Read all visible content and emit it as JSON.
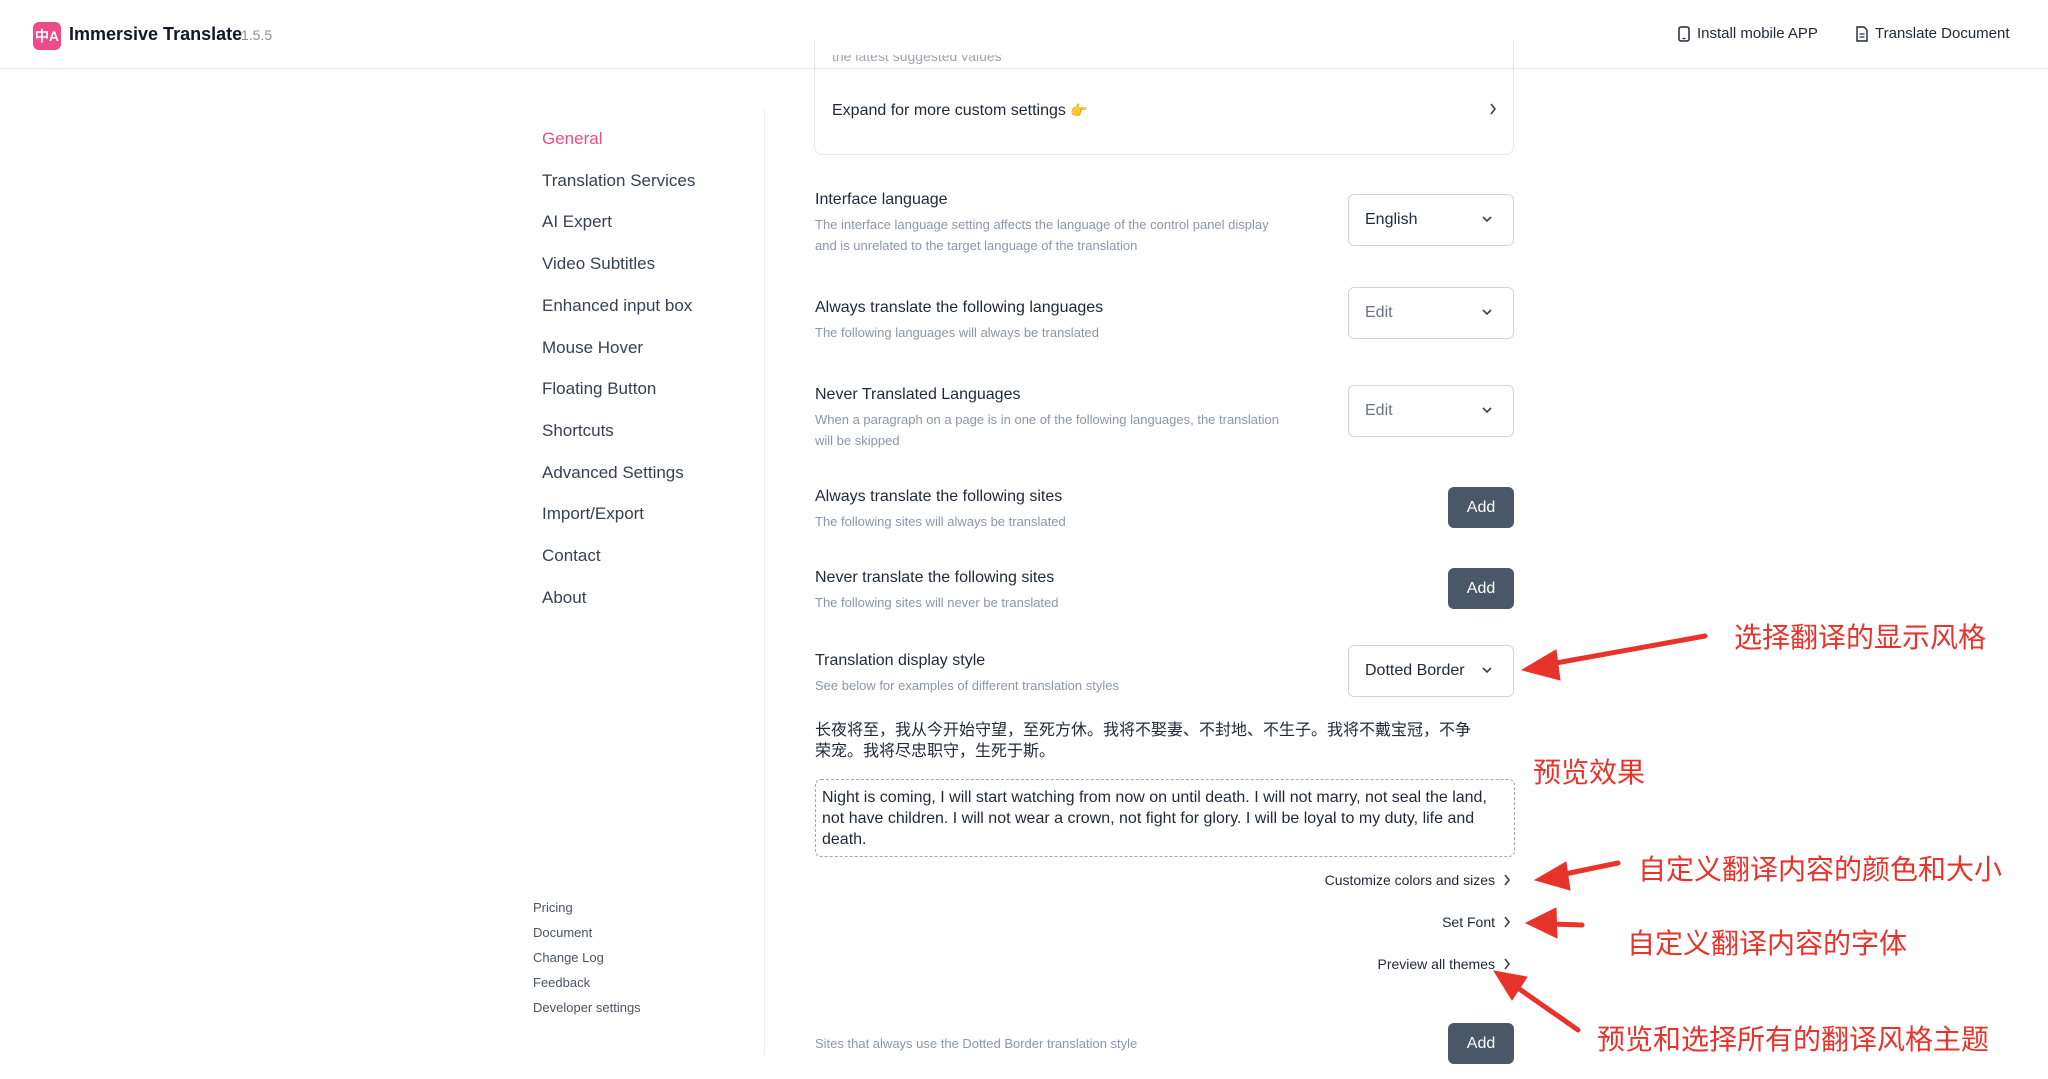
{
  "header": {
    "logo_text": "中A",
    "app_name": "Immersive Translate",
    "version": "1.5.5",
    "install_mobile": "Install mobile APP",
    "translate_document": "Translate Document"
  },
  "sidebar": {
    "items": [
      {
        "label": "General",
        "active": true
      },
      {
        "label": "Translation Services"
      },
      {
        "label": "AI Expert"
      },
      {
        "label": "Video Subtitles"
      },
      {
        "label": "Enhanced input box"
      },
      {
        "label": "Mouse Hover"
      },
      {
        "label": "Floating Button"
      },
      {
        "label": "Shortcuts"
      },
      {
        "label": "Advanced Settings"
      },
      {
        "label": "Import/Export"
      },
      {
        "label": "Contact"
      },
      {
        "label": "About"
      }
    ],
    "footer_links": [
      "Pricing",
      "Document",
      "Change Log",
      "Feedback",
      "Developer settings"
    ]
  },
  "top_card": {
    "faded_text": "the latest suggested values",
    "expand_label": "Expand for more custom settings",
    "expand_emoji": "👉"
  },
  "settings": {
    "interface_language": {
      "title": "Interface language",
      "desc_line1": "The interface language setting affects the language of the control panel display",
      "desc_line2": "and is unrelated to the target language of the translation",
      "value": "English"
    },
    "always_translate_langs": {
      "title": "Always translate the following languages",
      "desc": "The following languages will always be translated",
      "value": "Edit"
    },
    "never_translated_langs": {
      "title": "Never Translated Languages",
      "desc_line1": "When a paragraph on a page is in one of the following languages, the translation",
      "desc_line2": "will be skipped",
      "value": "Edit"
    },
    "always_translate_sites": {
      "title": "Always translate the following sites",
      "desc": "The following sites will always be translated",
      "button": "Add"
    },
    "never_translate_sites": {
      "title": "Never translate the following sites",
      "desc": "The following sites will never be translated",
      "button": "Add"
    },
    "display_style": {
      "title": "Translation display style",
      "desc": "See below for examples of different translation styles",
      "value": "Dotted Border"
    },
    "sites_dotted": {
      "desc": "Sites that always use the Dotted Border translation style",
      "button": "Add"
    }
  },
  "preview": {
    "source_line1": "长夜将至，我从今开始守望，至死方休。我将不娶妻、不封地、不生子。我将不戴宝冠，不争",
    "source_line2": "荣宠。我将尽忠职守，生死于斯。",
    "translated": "Night is coming, I will start watching from now on until death. I will not marry, not seal the land, not have children. I will not wear a crown, not fight for glory. I will be loyal to my duty, life and death."
  },
  "links": {
    "customize_colors": "Customize colors and sizes",
    "set_font": "Set Font",
    "preview_themes": "Preview all themes"
  },
  "annotations": {
    "display_style": "选择翻译的显示风格",
    "preview_effect": "预览效果",
    "colors_sizes": "自定义翻译内容的颜色和大小",
    "font": "自定义翻译内容的字体",
    "themes": "预览和选择所有的翻译风格主题"
  },
  "colors": {
    "accent": "#ea4c89",
    "button_bg": "#4a5766",
    "annotation": "#e8332b"
  }
}
